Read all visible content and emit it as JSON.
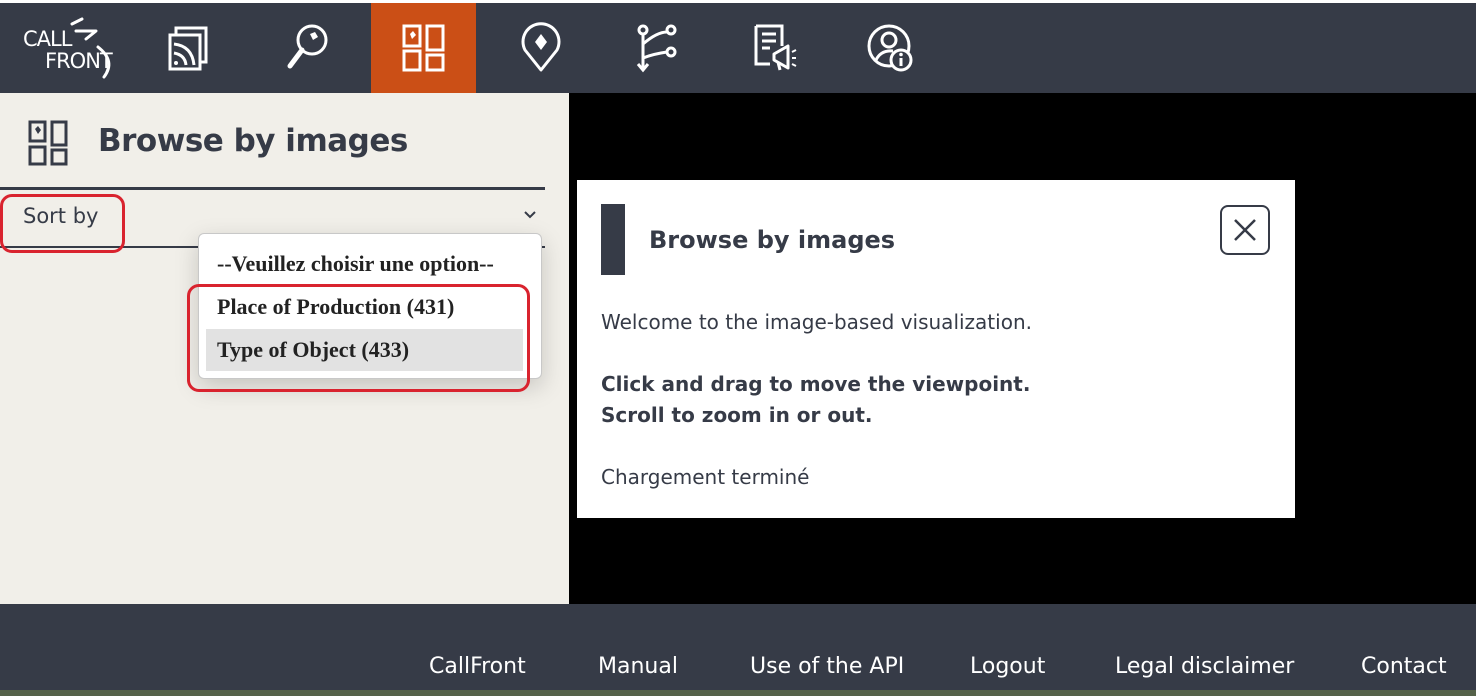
{
  "brand": {
    "logo_line1": "CALL",
    "logo_line2": "FRONT"
  },
  "nav": {
    "items": [
      {
        "name": "gallery-icon",
        "active": false
      },
      {
        "name": "search-icon",
        "active": false
      },
      {
        "name": "browse-images-icon",
        "active": true
      },
      {
        "name": "map-pin-icon",
        "active": false
      },
      {
        "name": "network-icon",
        "active": false
      },
      {
        "name": "announcements-icon",
        "active": false
      },
      {
        "name": "account-info-icon",
        "active": false
      }
    ]
  },
  "left_panel": {
    "title": "Browse by images",
    "sort_label": "Sort by",
    "dropdown_options": [
      "--Veuillez choisir une option--",
      "Place of Production (431)",
      "Type of Object (433)"
    ],
    "highlighted_option": "Type of Object (433)"
  },
  "modal": {
    "title": "Browse by images",
    "intro": "Welcome to the image-based visualization.",
    "instruction1": "Click and drag to move the viewpoint.",
    "instruction2": "Scroll to zoom in or out.",
    "status": "Chargement terminé"
  },
  "footer": {
    "links": [
      "CallFront",
      "Manual",
      "Use of the API",
      "Logout",
      "Legal disclaimer",
      "Contact"
    ]
  },
  "colors": {
    "nav_bg": "#363b47",
    "accent": "#cb4f16",
    "panel_bg": "#f1efe9",
    "annotation_red": "#d9232e"
  }
}
